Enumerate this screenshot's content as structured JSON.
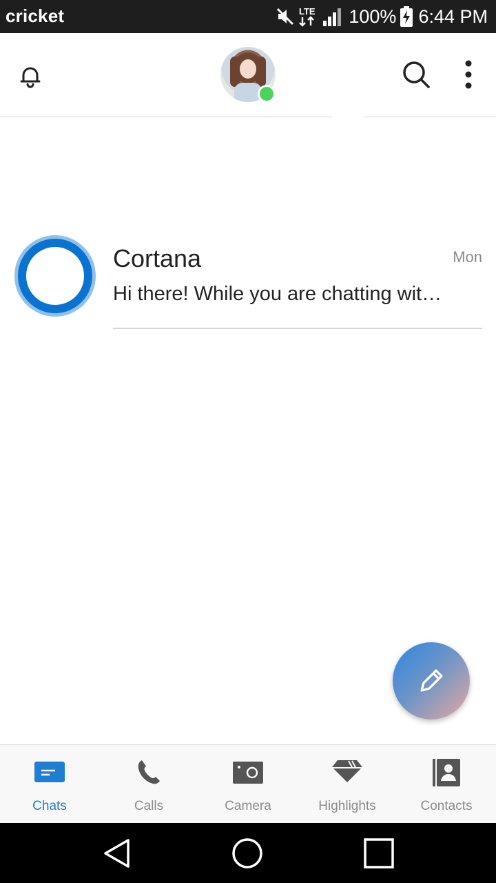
{
  "status_bar": {
    "carrier": "cricket",
    "network": "LTE",
    "battery": "100%",
    "time": "6:44 PM"
  },
  "header": {
    "notifications_icon": "bell-icon",
    "avatar_status": "online",
    "search_icon": "search-icon",
    "more_icon": "more-vertical-icon"
  },
  "chats": [
    {
      "name": "Cortana",
      "time": "Mon",
      "preview": "Hi there! While you are chatting wit…"
    }
  ],
  "fab": {
    "icon": "pencil-icon"
  },
  "tabs": [
    {
      "label": "Chats",
      "icon": "chat-bubble-icon",
      "active": true
    },
    {
      "label": "Calls",
      "icon": "phone-icon",
      "active": false
    },
    {
      "label": "Camera",
      "icon": "camera-icon",
      "active": false
    },
    {
      "label": "Highlights",
      "icon": "highlights-icon",
      "active": false
    },
    {
      "label": "Contacts",
      "icon": "contacts-icon",
      "active": false
    }
  ],
  "colors": {
    "accent": "#1f7ed1",
    "presence": "#4bd35b",
    "cortana_ring": "#0a72d0"
  }
}
